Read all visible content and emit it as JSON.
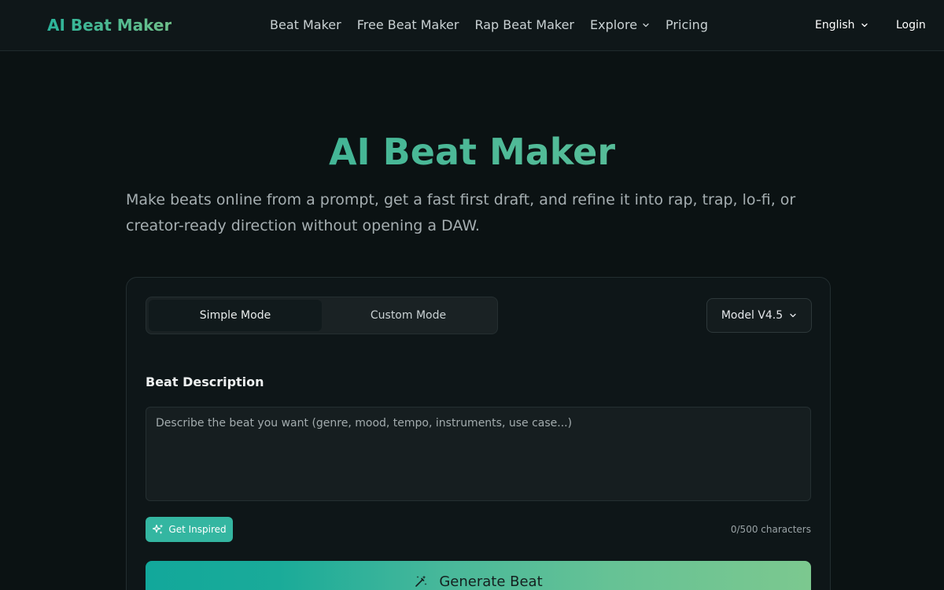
{
  "header": {
    "logo": "AI Beat Maker",
    "nav": [
      {
        "label": "Beat Maker"
      },
      {
        "label": "Free Beat Maker"
      },
      {
        "label": "Rap Beat Maker"
      },
      {
        "label": "Explore",
        "has_dropdown": true
      },
      {
        "label": "Pricing"
      }
    ],
    "language": "English",
    "login": "Login"
  },
  "hero": {
    "title": "AI Beat Maker",
    "subtitle": "Make beats online from a prompt, get a fast first draft, and refine it into rap, trap, lo-fi, or creator-ready direction without opening a DAW."
  },
  "generator": {
    "modes": [
      {
        "label": "Simple Mode",
        "active": true
      },
      {
        "label": "Custom Mode",
        "active": false
      }
    ],
    "model": "Model V4.5",
    "description_label": "Beat Description",
    "description_placeholder": "Describe the beat you want (genre, mood, tempo, instruments, use case...)",
    "description_value": "",
    "inspire_label": "Get Inspired",
    "char_count": "0/500 characters",
    "generate_label": "Generate Beat"
  },
  "colors": {
    "background": "#0b1213",
    "accent": "#34b6a1",
    "gradient_start": "#12a89b",
    "gradient_end": "#7cc88f"
  },
  "icons": {
    "explore_chevron": "chevron-down-icon",
    "language_chevron": "chevron-down-icon",
    "model_chevron": "chevron-down-icon",
    "inspire": "sparkles-icon",
    "generate": "magic-wand-icon"
  }
}
